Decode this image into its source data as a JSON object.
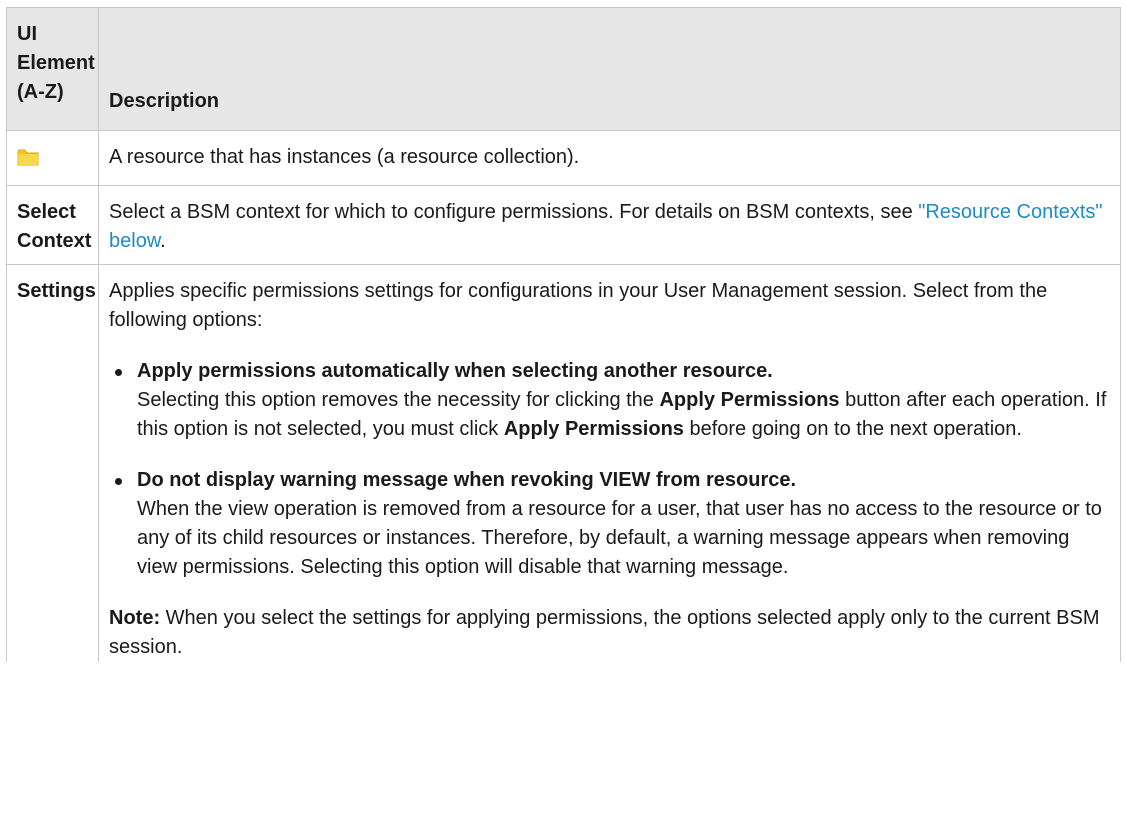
{
  "header": {
    "element_col": "UI Element (A-Z)",
    "element_col_lines": [
      "UI",
      "Element",
      "(A-Z)"
    ],
    "description_col": "Description"
  },
  "rows": [
    {
      "element_icon": "folder-icon",
      "description": "A resource that has instances (a resource collection)."
    },
    {
      "element_lines": [
        "Select",
        "Context"
      ],
      "description_pre": "Select a BSM context for which to configure permissions. For details on BSM contexts, see ",
      "link_text": "\"Resource Contexts\" below",
      "description_post": "."
    },
    {
      "element": "Settings",
      "intro": "Applies specific permissions settings for configurations in your User Management session. Select from the following options:",
      "options": [
        {
          "title": "Apply permissions automatically when selecting another resource.",
          "text_1": "Selecting this option removes the necessity for clicking the ",
          "bold_1": "Apply Permissions",
          "text_2": " button after each operation. If this option is not selected, you must click ",
          "bold_2": "Apply Permissions",
          "text_3": " before going on to the next operation."
        },
        {
          "title": "Do not display warning message when revoking VIEW from resource.",
          "text": "When the view operation is removed from a resource for a user, that user has no access to the resource or to any of its child resources or instances. Therefore, by default, a warning message appears when removing view permissions. Selecting this option will disable that warning message."
        }
      ],
      "note_label": "Note:",
      "note_text": " When you select the settings for applying permissions, the options selected apply only to the current BSM session."
    }
  ],
  "colors": {
    "header_bg": "#e6e6e6",
    "border": "#c9c9c9",
    "link": "#1e8bc3",
    "folder": "#f2c61f"
  }
}
